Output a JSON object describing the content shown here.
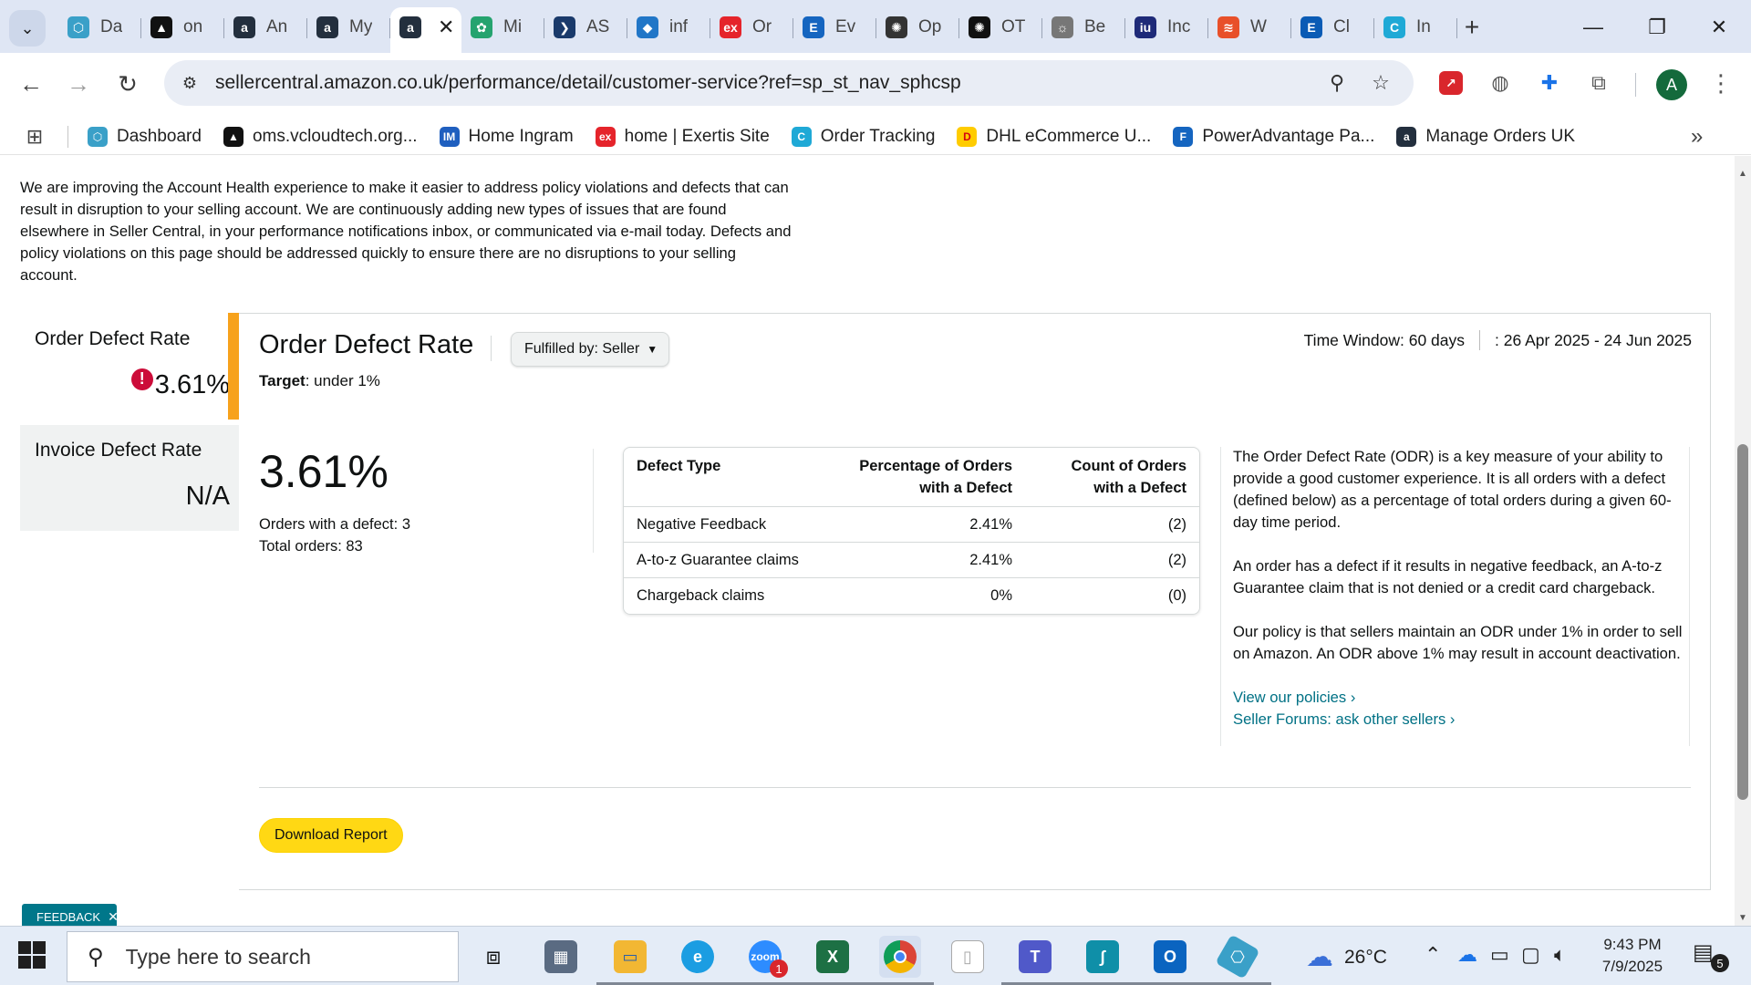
{
  "browser": {
    "tabs": [
      {
        "title": "Da",
        "icon": "hexagon-icon",
        "color": "#3aa0c8"
      },
      {
        "title": "on",
        "icon": "triangle-icon",
        "color": "#111111"
      },
      {
        "title": "An",
        "icon": "amazon-icon",
        "color": "#232f3e"
      },
      {
        "title": "My",
        "icon": "amazon-icon",
        "color": "#232f3e"
      },
      {
        "title": "",
        "icon": "amazon-icon",
        "color": "#232f3e",
        "active": true
      },
      {
        "title": "Mi",
        "icon": "leaf-icon",
        "color": "#25a36f"
      },
      {
        "title": "AS",
        "icon": "arrow-icon",
        "color": "#1a3a6b"
      },
      {
        "title": "inf",
        "icon": "cube-icon",
        "color": "#2176c7"
      },
      {
        "title": "Or",
        "icon": "exertis-icon",
        "color": "#e5242b"
      },
      {
        "title": "Ev",
        "icon": "e-icon",
        "color": "#1565c0"
      },
      {
        "title": "Op",
        "icon": "openai-icon",
        "color": "#333333"
      },
      {
        "title": "OT",
        "icon": "openai-icon",
        "color": "#111111"
      },
      {
        "title": "Be",
        "icon": "bulb-icon",
        "color": "#777777"
      },
      {
        "title": "Inc",
        "icon": "iu-icon",
        "color": "#1e2a78"
      },
      {
        "title": "W",
        "icon": "layers-icon",
        "color": "#e8502a"
      },
      {
        "title": "Cl",
        "icon": "etn-icon",
        "color": "#0a5bb5"
      },
      {
        "title": "In",
        "icon": "c-icon",
        "color": "#1fa9d6"
      }
    ],
    "active_tab_close": "✕",
    "new_tab": "+",
    "url": "sellercentral.amazon.co.uk/performance/detail/customer-service?ref=sp_st_nav_sphcsp",
    "avatar_letter": "A",
    "bookmarks": [
      {
        "label": "Dashboard",
        "icon": "hexagon-icon",
        "color": "#3aa0c8"
      },
      {
        "label": "oms.vcloudtech.org...",
        "icon": "triangle-icon",
        "color": "#111111"
      },
      {
        "label": "Home Ingram",
        "icon": "im-icon",
        "color": "#1f5fbf"
      },
      {
        "label": "home | Exertis Site",
        "icon": "exertis-icon",
        "color": "#e5242b"
      },
      {
        "label": "Order Tracking",
        "icon": "c-icon",
        "color": "#1fa9d6"
      },
      {
        "label": "DHL eCommerce U...",
        "icon": "dhl-icon",
        "color": "#ffcc00"
      },
      {
        "label": "PowerAdvantage Pa...",
        "icon": "doc-icon",
        "color": "#1565c0"
      },
      {
        "label": "Manage Orders UK",
        "icon": "amazon-icon",
        "color": "#232f3e"
      }
    ]
  },
  "page": {
    "intro": "We are improving the Account Health experience to make it easier to address policy violations and defects that can result in disruption to your selling account. We are continuously adding new types of issues that are found elsewhere in Seller Central, in your performance notifications inbox, or communicated via e-mail today. Defects and policy violations on this page should be addressed quickly to ensure there are no disruptions to your selling account.",
    "sidebar": [
      {
        "title": "Order Defect Rate",
        "value": "3.61%",
        "alert": "!"
      },
      {
        "title": "Invoice Defect Rate",
        "value": "N/A"
      }
    ],
    "panel": {
      "title": "Order Defect Rate",
      "fulfilled_by": "Fulfilled by: Seller",
      "target_label": "Target",
      "target_value": ": under 1%",
      "time_window": "Time Window: 60 days",
      "date_range": ": 26 Apr 2025 - 24 Jun 2025",
      "rate": "3.61%",
      "orders_with_defect": "Orders with a defect: 3",
      "total_orders": "Total orders: 83",
      "table": {
        "headers": [
          "Defect Type",
          "Percentage of Orders with a Defect",
          "Count of Orders with a Defect"
        ],
        "rows": [
          [
            "Negative Feedback",
            "2.41%",
            "(2)"
          ],
          [
            "A-to-z Guarantee claims",
            "2.41%",
            "(2)"
          ],
          [
            "Chargeback claims",
            "0%",
            "(0)"
          ]
        ]
      },
      "description": [
        "The Order Defect Rate (ODR) is a key measure of your ability to provide a good customer experience. It is all orders with a defect (defined below) as a percentage of total orders during a given 60-day time period.",
        "An order has a defect if it results in negative feedback, an A-to-z Guarantee claim that is not denied or a credit card chargeback.",
        "Our policy is that sellers maintain an ODR under 1% in order to sell on Amazon. An ODR above 1% may result in account deactivation."
      ],
      "links": [
        "View our policies ›",
        "Seller Forums: ask other sellers ›"
      ],
      "download_label": "Download Report"
    },
    "feedback_label": "FEEDBACK",
    "feedback_close": "✕"
  },
  "taskbar": {
    "search_placeholder": "Type here to search",
    "weather_temp": "26°C",
    "time": "9:43 PM",
    "date": "7/9/2025",
    "notification_count": "5",
    "zoom_badge": "1"
  }
}
